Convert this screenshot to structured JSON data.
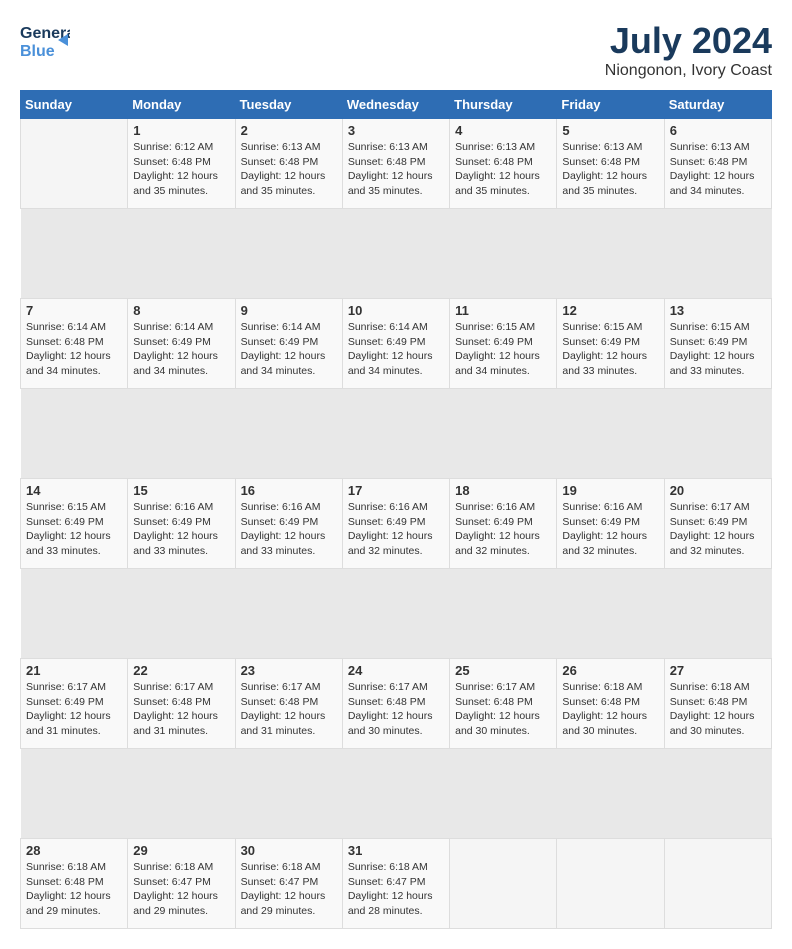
{
  "logo": {
    "line1": "General",
    "line2": "Blue"
  },
  "title": "July 2024",
  "location": "Niongonon, Ivory Coast",
  "headers": [
    "Sunday",
    "Monday",
    "Tuesday",
    "Wednesday",
    "Thursday",
    "Friday",
    "Saturday"
  ],
  "weeks": [
    [
      {
        "day": "",
        "info": ""
      },
      {
        "day": "1",
        "info": "Sunrise: 6:12 AM\nSunset: 6:48 PM\nDaylight: 12 hours\nand 35 minutes."
      },
      {
        "day": "2",
        "info": "Sunrise: 6:13 AM\nSunset: 6:48 PM\nDaylight: 12 hours\nand 35 minutes."
      },
      {
        "day": "3",
        "info": "Sunrise: 6:13 AM\nSunset: 6:48 PM\nDaylight: 12 hours\nand 35 minutes."
      },
      {
        "day": "4",
        "info": "Sunrise: 6:13 AM\nSunset: 6:48 PM\nDaylight: 12 hours\nand 35 minutes."
      },
      {
        "day": "5",
        "info": "Sunrise: 6:13 AM\nSunset: 6:48 PM\nDaylight: 12 hours\nand 35 minutes."
      },
      {
        "day": "6",
        "info": "Sunrise: 6:13 AM\nSunset: 6:48 PM\nDaylight: 12 hours\nand 34 minutes."
      }
    ],
    [
      {
        "day": "7",
        "info": "Sunrise: 6:14 AM\nSunset: 6:48 PM\nDaylight: 12 hours\nand 34 minutes."
      },
      {
        "day": "8",
        "info": "Sunrise: 6:14 AM\nSunset: 6:49 PM\nDaylight: 12 hours\nand 34 minutes."
      },
      {
        "day": "9",
        "info": "Sunrise: 6:14 AM\nSunset: 6:49 PM\nDaylight: 12 hours\nand 34 minutes."
      },
      {
        "day": "10",
        "info": "Sunrise: 6:14 AM\nSunset: 6:49 PM\nDaylight: 12 hours\nand 34 minutes."
      },
      {
        "day": "11",
        "info": "Sunrise: 6:15 AM\nSunset: 6:49 PM\nDaylight: 12 hours\nand 34 minutes."
      },
      {
        "day": "12",
        "info": "Sunrise: 6:15 AM\nSunset: 6:49 PM\nDaylight: 12 hours\nand 33 minutes."
      },
      {
        "day": "13",
        "info": "Sunrise: 6:15 AM\nSunset: 6:49 PM\nDaylight: 12 hours\nand 33 minutes."
      }
    ],
    [
      {
        "day": "14",
        "info": "Sunrise: 6:15 AM\nSunset: 6:49 PM\nDaylight: 12 hours\nand 33 minutes."
      },
      {
        "day": "15",
        "info": "Sunrise: 6:16 AM\nSunset: 6:49 PM\nDaylight: 12 hours\nand 33 minutes."
      },
      {
        "day": "16",
        "info": "Sunrise: 6:16 AM\nSunset: 6:49 PM\nDaylight: 12 hours\nand 33 minutes."
      },
      {
        "day": "17",
        "info": "Sunrise: 6:16 AM\nSunset: 6:49 PM\nDaylight: 12 hours\nand 32 minutes."
      },
      {
        "day": "18",
        "info": "Sunrise: 6:16 AM\nSunset: 6:49 PM\nDaylight: 12 hours\nand 32 minutes."
      },
      {
        "day": "19",
        "info": "Sunrise: 6:16 AM\nSunset: 6:49 PM\nDaylight: 12 hours\nand 32 minutes."
      },
      {
        "day": "20",
        "info": "Sunrise: 6:17 AM\nSunset: 6:49 PM\nDaylight: 12 hours\nand 32 minutes."
      }
    ],
    [
      {
        "day": "21",
        "info": "Sunrise: 6:17 AM\nSunset: 6:49 PM\nDaylight: 12 hours\nand 31 minutes."
      },
      {
        "day": "22",
        "info": "Sunrise: 6:17 AM\nSunset: 6:48 PM\nDaylight: 12 hours\nand 31 minutes."
      },
      {
        "day": "23",
        "info": "Sunrise: 6:17 AM\nSunset: 6:48 PM\nDaylight: 12 hours\nand 31 minutes."
      },
      {
        "day": "24",
        "info": "Sunrise: 6:17 AM\nSunset: 6:48 PM\nDaylight: 12 hours\nand 30 minutes."
      },
      {
        "day": "25",
        "info": "Sunrise: 6:17 AM\nSunset: 6:48 PM\nDaylight: 12 hours\nand 30 minutes."
      },
      {
        "day": "26",
        "info": "Sunrise: 6:18 AM\nSunset: 6:48 PM\nDaylight: 12 hours\nand 30 minutes."
      },
      {
        "day": "27",
        "info": "Sunrise: 6:18 AM\nSunset: 6:48 PM\nDaylight: 12 hours\nand 30 minutes."
      }
    ],
    [
      {
        "day": "28",
        "info": "Sunrise: 6:18 AM\nSunset: 6:48 PM\nDaylight: 12 hours\nand 29 minutes."
      },
      {
        "day": "29",
        "info": "Sunrise: 6:18 AM\nSunset: 6:47 PM\nDaylight: 12 hours\nand 29 minutes."
      },
      {
        "day": "30",
        "info": "Sunrise: 6:18 AM\nSunset: 6:47 PM\nDaylight: 12 hours\nand 29 minutes."
      },
      {
        "day": "31",
        "info": "Sunrise: 6:18 AM\nSunset: 6:47 PM\nDaylight: 12 hours\nand 28 minutes."
      },
      {
        "day": "",
        "info": ""
      },
      {
        "day": "",
        "info": ""
      },
      {
        "day": "",
        "info": ""
      }
    ]
  ]
}
